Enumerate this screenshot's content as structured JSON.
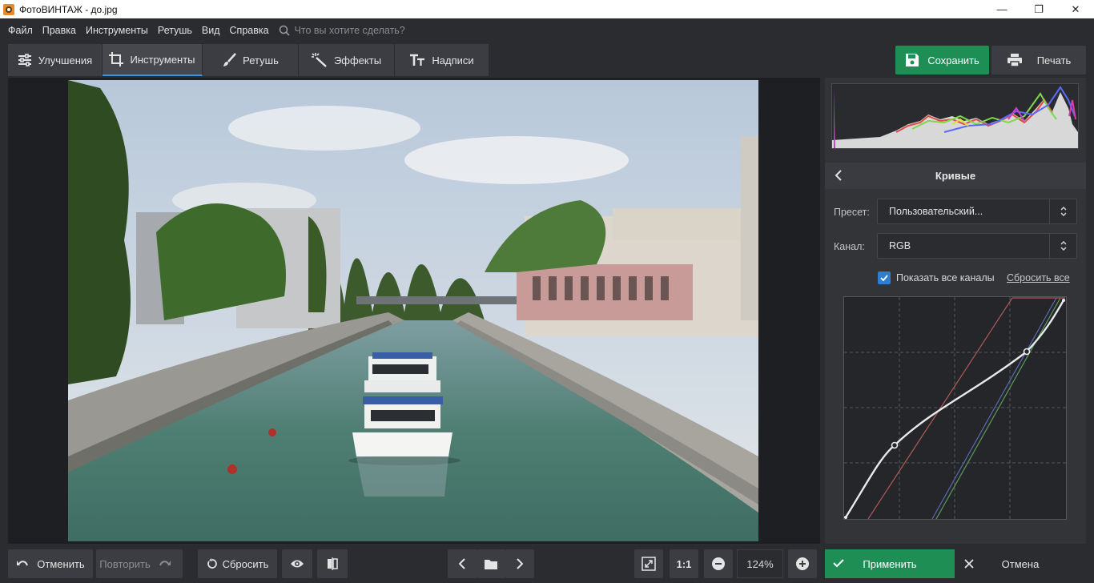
{
  "window": {
    "title": "ФотоВИНТАЖ - до.jpg",
    "minimize_icon": "—",
    "maximize_icon": "❐",
    "close_icon": "✕"
  },
  "menu": {
    "items": [
      "Файл",
      "Правка",
      "Инструменты",
      "Ретушь",
      "Вид",
      "Справка"
    ],
    "search_placeholder": "Что вы хотите сделать?"
  },
  "tabs": [
    {
      "label": "Улучшения",
      "icon": "sliders-icon"
    },
    {
      "label": "Инструменты",
      "icon": "crop-icon",
      "active": true
    },
    {
      "label": "Ретушь",
      "icon": "brush-icon"
    },
    {
      "label": "Эффекты",
      "icon": "magic-wand-icon"
    },
    {
      "label": "Надписи",
      "icon": "text-icon"
    }
  ],
  "toolbar": {
    "save_label": "Сохранить",
    "print_label": "Печать"
  },
  "curves": {
    "title": "Кривые",
    "preset_label": "Пресет:",
    "preset_value": "Пользовательский...",
    "channel_label": "Канал:",
    "channel_value": "RGB",
    "show_all_label": "Показать все каналы",
    "show_all_checked": true,
    "reset_all_label": "Сбросить все"
  },
  "bottom": {
    "undo_label": "Отменить",
    "redo_label": "Повторить",
    "reset_label": "Сбросить",
    "zoom_ratio_label": "1:1",
    "zoom_value": "124%",
    "apply_label": "Применить",
    "cancel_label": "Отмена"
  },
  "colors": {
    "accent_green": "#1e8e55",
    "accent_blue": "#2f7fd0",
    "panel_bg": "#333438"
  }
}
